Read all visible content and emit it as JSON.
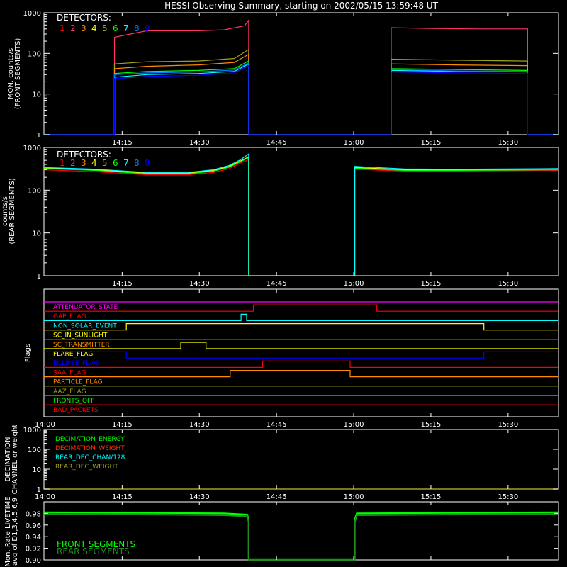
{
  "chart_data": {
    "type": "line",
    "title": "HESSI Observing Summary, starting on 2002/05/15 13:59:48 UT",
    "x_time_axis": {
      "range_minutes": [
        0,
        40
      ],
      "tick_labels": [
        "14:15",
        "14:30",
        "14:45",
        "15:00",
        "15:15",
        "15:30"
      ],
      "tick_labels_with_start": [
        "14:00",
        "14:15",
        "14:30",
        "14:45",
        "15:00",
        "15:15",
        "15:30"
      ],
      "tick_minutes": [
        15,
        30,
        45,
        60,
        75,
        90
      ],
      "tick_minutes_with_start": [
        0,
        15,
        30,
        45,
        60,
        75,
        90
      ]
    },
    "colors": {
      "background": "#000000",
      "axes": "#ffffff",
      "det1": "#ff0000",
      "det2": "#ff3366",
      "det3": "#ff8c00",
      "det4": "#ffff00",
      "det5": "#a0a020",
      "det6": "#00ff00",
      "det7": "#00ffff",
      "det8": "#0080ff",
      "det9": "#0000ff"
    },
    "panels": [
      {
        "id": "front",
        "ylabel": "MON. counts/s",
        "ylabel2": "(FRONT SEGMENTS)",
        "yscale": "log",
        "ylim": [
          1,
          1000
        ],
        "y_tick_labels": [
          "1",
          "10",
          "100",
          "1000"
        ],
        "legend_title": "DETECTORS:",
        "legend_items": [
          "1",
          "2",
          "3",
          "4",
          "5",
          "6",
          "7",
          "8",
          "9"
        ],
        "series": [
          {
            "color": "det2",
            "x": [
              0,
              13.7,
              13.7,
              20,
              30,
              35,
              39,
              39.8,
              39.8,
              67.5,
              67.5,
              75,
              85,
              94,
              94,
              100
            ],
            "y": [
              1,
              1,
              250,
              360,
              360,
              380,
              480,
              650,
              1,
              1,
              430,
              410,
              400,
              400,
              1,
              1
            ]
          },
          {
            "color": "det5",
            "x": [
              0,
              13.7,
              13.7,
              20,
              30,
              37,
              39.8,
              39.8,
              67.5,
              67.5,
              80,
              94,
              94,
              100
            ],
            "y": [
              1,
              1,
              55,
              62,
              65,
              75,
              125,
              1,
              1,
              72,
              68,
              65,
              1,
              1
            ]
          },
          {
            "color": "det3",
            "x": [
              0,
              13.7,
              13.7,
              20,
              30,
              37,
              39.8,
              39.8,
              67.5,
              67.5,
              80,
              94,
              94,
              100
            ],
            "y": [
              1,
              1,
              42,
              48,
              52,
              60,
              95,
              1,
              1,
              55,
              52,
              50,
              1,
              1
            ]
          },
          {
            "color": "det6",
            "x": [
              0,
              13.7,
              13.7,
              20,
              30,
              37,
              39.8,
              39.8,
              67.5,
              67.5,
              80,
              94,
              94,
              100
            ],
            "y": [
              1,
              1,
              32,
              36,
              38,
              42,
              65,
              1,
              1,
              42,
              40,
              38,
              1,
              1
            ]
          },
          {
            "color": "det7",
            "x": [
              0,
              13.7,
              13.7,
              20,
              30,
              37,
              39.8,
              39.8,
              67.5,
              67.5,
              80,
              94,
              94,
              100
            ],
            "y": [
              1,
              1,
              26,
              30,
              32,
              36,
              55,
              1,
              1,
              38,
              36,
              35,
              1,
              1
            ]
          },
          {
            "color": "det8",
            "x": [
              0,
              13.7,
              13.7,
              20,
              30,
              37,
              39.8,
              39.8,
              67.5,
              67.5,
              80,
              94,
              94,
              100
            ],
            "y": [
              1,
              1,
              30,
              33,
              35,
              39,
              58,
              1,
              1,
              40,
              37,
              36,
              1,
              1
            ]
          },
          {
            "color": "det9",
            "x": [
              0,
              13.7,
              13.7,
              20,
              30,
              37,
              39.8,
              39.8,
              67.5,
              67.5,
              80,
              94,
              94,
              100
            ],
            "y": [
              1,
              1,
              24,
              27,
              29,
              33,
              50,
              1,
              1,
              35,
              33,
              32,
              1,
              1
            ]
          }
        ]
      },
      {
        "id": "rear",
        "ylabel": "counts/s",
        "ylabel2": "(REAR SEGMENTS)",
        "yscale": "log",
        "ylim": [
          1,
          1000
        ],
        "y_tick_labels": [
          "1",
          "10",
          "100",
          "1000"
        ],
        "legend_title": "DETECTORS:",
        "legend_items": [
          "1",
          "2",
          "3",
          "4",
          "5",
          "6",
          "7",
          "8",
          "9"
        ],
        "series": [
          {
            "color": "det1",
            "x": [
              0,
              10,
              20,
              28,
              33,
              36,
              38,
              39.8,
              39.8,
              60.4,
              60.4,
              70,
              80,
              90,
              100
            ],
            "y": [
              300,
              270,
              230,
              230,
              260,
              320,
              420,
              520,
              1,
              1,
              310,
              280,
              280,
              285,
              290
            ]
          },
          {
            "color": "det4",
            "x": [
              0,
              10,
              20,
              28,
              33,
              36,
              38,
              39.8,
              39.8,
              60.4,
              60.4,
              70,
              80,
              90,
              100
            ],
            "y": [
              330,
              300,
              250,
              250,
              290,
              360,
              470,
              600,
              1,
              1,
              340,
              300,
              300,
              305,
              310
            ]
          },
          {
            "color": "det6",
            "x": [
              0,
              10,
              20,
              28,
              33,
              36,
              38,
              39.8,
              39.8,
              60.4,
              60.4,
              70,
              80,
              90,
              100
            ],
            "y": [
              320,
              290,
              240,
              240,
              280,
              345,
              450,
              580,
              1,
              1,
              325,
              290,
              290,
              295,
              300
            ]
          },
          {
            "color": "det7",
            "x": [
              0,
              10,
              20,
              28,
              33,
              36,
              38,
              39.8,
              39.8,
              60.4,
              60.4,
              70,
              80,
              90,
              100
            ],
            "y": [
              340,
              310,
              260,
              260,
              300,
              380,
              500,
              700,
              1,
              1,
              360,
              315,
              310,
              315,
              320
            ]
          }
        ]
      }
    ],
    "flags": {
      "ylabel": "Flags",
      "items": [
        {
          "name": "ATTENUATOR_STATE",
          "color": "#ff00ff",
          "x": [
            0,
            100
          ],
          "state": [
            0,
            0
          ]
        },
        {
          "name": "GAP_FLAG",
          "color": "#ff0000",
          "x": [
            0,
            40.7,
            40.7,
            64.7,
            64.7,
            100
          ],
          "state": [
            0,
            0,
            1,
            1,
            0,
            0
          ]
        },
        {
          "name": "NON_SOLAR_EVENT",
          "color": "#00ffff",
          "x": [
            0,
            38.3,
            38.3,
            39.4,
            39.4,
            100
          ],
          "state": [
            0,
            0,
            1,
            1,
            0,
            0
          ]
        },
        {
          "name": "SC_IN_SUNLIGHT",
          "color": "#ffff00",
          "x": [
            0,
            16,
            16,
            85.5,
            85.5,
            100
          ],
          "state": [
            0,
            0,
            1,
            1,
            0,
            0
          ]
        },
        {
          "name": "SC_TRANSMITTER",
          "color": "#ff8c00",
          "x": [
            0,
            100
          ],
          "state": [
            0,
            0
          ]
        },
        {
          "name": "FLARE_FLAG",
          "color": "#ffff00",
          "x": [
            0,
            26.6,
            26.6,
            31.5,
            31.5,
            100
          ],
          "state": [
            0,
            0,
            1,
            1,
            0,
            0
          ]
        },
        {
          "name": "ECLIPSE_FLAG",
          "color": "#0000ff",
          "x": [
            0,
            16,
            16,
            85.5,
            85.5,
            100
          ],
          "state": [
            1,
            1,
            0,
            0,
            1,
            1
          ]
        },
        {
          "name": "SAA_FLAG",
          "color": "#ff0000",
          "x": [
            0,
            42.5,
            42.5,
            59.5,
            59.5,
            100
          ],
          "state": [
            0,
            0,
            1,
            1,
            0,
            0
          ]
        },
        {
          "name": "PARTICLE_FLAG",
          "color": "#ff8c00",
          "x": [
            0,
            36.2,
            36.2,
            59.5,
            59.5,
            100
          ],
          "state": [
            0,
            0,
            1,
            1,
            0,
            0
          ]
        },
        {
          "name": "AAZ_FLAG",
          "color": "#a0a020",
          "x": [
            0,
            100
          ],
          "state": [
            0,
            0
          ]
        },
        {
          "name": "FRONTS_OFF",
          "color": "#00ff00",
          "x": [
            0,
            100
          ],
          "state": [
            0,
            0
          ]
        },
        {
          "name": "BAD_PACKETS",
          "color": "#ff0000",
          "x": [
            0,
            100
          ],
          "state": [
            0,
            0
          ]
        }
      ]
    },
    "decimation": {
      "ylabel": "DECIMATION",
      "ylabel2": "CHANNEL or weight",
      "yscale": "log",
      "ylim": [
        1,
        1000
      ],
      "y_tick_labels": [
        "1",
        "10",
        "100",
        "1000"
      ],
      "legend": [
        {
          "name": "DECIMATION_ENERGY",
          "color": "#00ff00"
        },
        {
          "name": "DECIMATION_WEIGHT",
          "color": "#ff3300"
        },
        {
          "name": "REAR_DEC_CHAN/128",
          "color": "#00ffff"
        },
        {
          "name": "REAR_DEC_WEIGHT",
          "color": "#a0a020"
        }
      ]
    },
    "livetime": {
      "ylabel": "Mon. Rate LIVETIME",
      "ylabel2": "avg of D1,3,4,5,6,9",
      "ylim": [
        0.9,
        1.0
      ],
      "y_tick_labels": [
        "0.90",
        "0.92",
        "0.94",
        "0.96",
        "0.98"
      ],
      "y_tick_values": [
        0.9,
        0.92,
        0.94,
        0.96,
        0.98
      ],
      "legend": [
        {
          "name": "FRONT SEGMENTS",
          "color": "#00ff00"
        },
        {
          "name": "REAR SEGMENTS",
          "color": "#228b22"
        }
      ],
      "series": [
        {
          "name": "FRONT SEGMENTS",
          "color": "#00ff00",
          "x": [
            0,
            20,
            35,
            39.5,
            39.8,
            39.8,
            60.4,
            60.4,
            60.8,
            80,
            100
          ],
          "y": [
            0.982,
            0.981,
            0.98,
            0.978,
            0.97,
            0.9,
            0.9,
            0.97,
            0.98,
            0.981,
            0.982
          ]
        },
        {
          "name": "REAR SEGMENTS",
          "color": "#228b22",
          "x": [
            0,
            20,
            35,
            39.5,
            39.8,
            39.8,
            60.4,
            60.4,
            60.8,
            80,
            100
          ],
          "y": [
            0.979,
            0.978,
            0.977,
            0.975,
            0.965,
            0.9,
            0.9,
            0.965,
            0.977,
            0.978,
            0.979
          ]
        }
      ]
    }
  }
}
